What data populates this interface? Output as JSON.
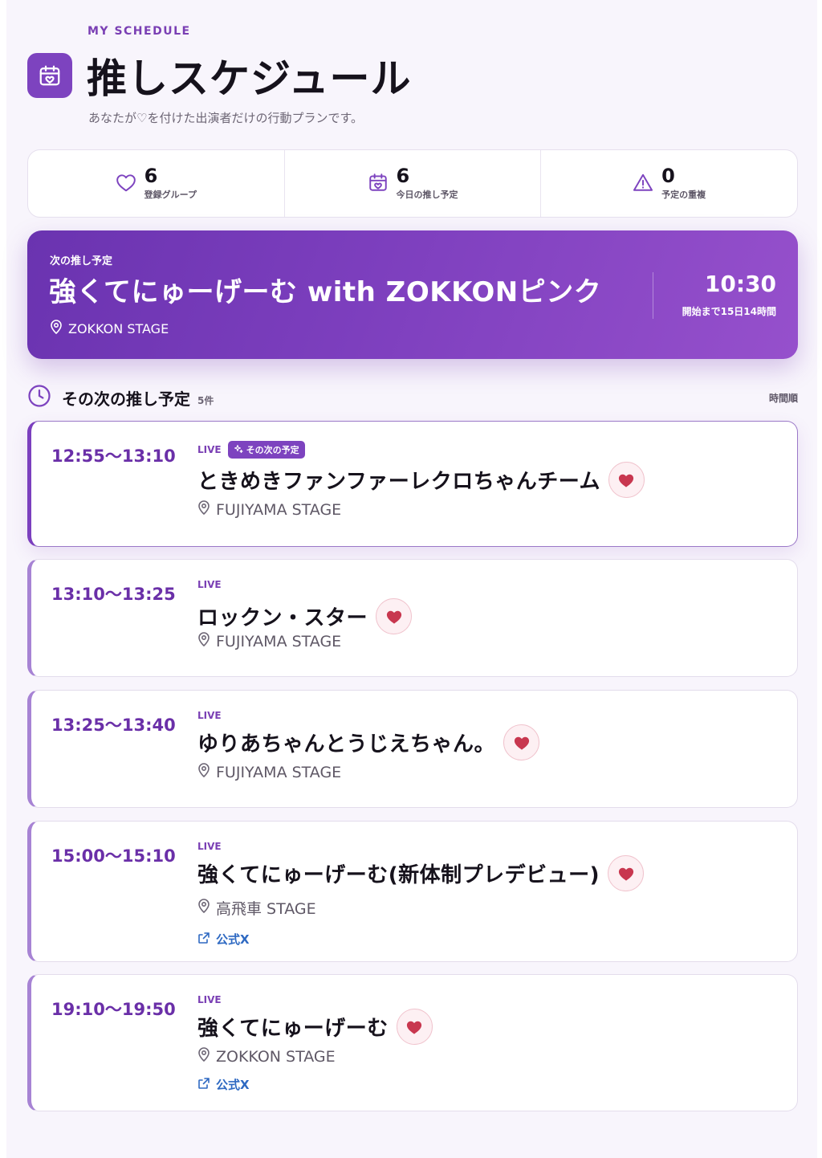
{
  "header": {
    "eyebrow": "MY SCHEDULE",
    "title": "推しスケジュール",
    "subtitle": "あなたが♡を付けた出演者だけの行動プランです。"
  },
  "stats": [
    {
      "value": "6",
      "label": "登録グループ",
      "icon": "heart-outline-icon"
    },
    {
      "value": "6",
      "label": "今日の推し予定",
      "icon": "calendar-heart-icon"
    },
    {
      "value": "0",
      "label": "予定の重複",
      "icon": "warning-icon"
    }
  ],
  "next": {
    "label": "次の推し予定",
    "name": "強くてにゅーげーむ with ZOKKONピンク",
    "stage": "ZOKKON STAGE",
    "time": "10:30",
    "countdown": "開始まで15日14時間"
  },
  "upcoming": {
    "title": "その次の推し予定",
    "count": "5件",
    "sort": "時間順",
    "items": [
      {
        "time": "12:55〜13:10",
        "type": "LIVE",
        "badge": "その次の予定",
        "name": "ときめきファンファーレクロちゃんチーム",
        "stage": "FUJIYAMA STAGE",
        "link": ""
      },
      {
        "time": "13:10〜13:25",
        "type": "LIVE",
        "badge": "",
        "name": "ロックン・スター",
        "stage": "FUJIYAMA STAGE",
        "link": ""
      },
      {
        "time": "13:25〜13:40",
        "type": "LIVE",
        "badge": "",
        "name": "ゆりあちゃんとうじえちゃん。",
        "stage": "FUJIYAMA STAGE",
        "link": ""
      },
      {
        "time": "15:00〜15:10",
        "type": "LIVE",
        "badge": "",
        "name": "強くてにゅーげーむ(新体制プレデビュー)",
        "stage": "高飛車 STAGE",
        "link": "公式X"
      },
      {
        "time": "19:10〜19:50",
        "type": "LIVE",
        "badge": "",
        "name": "強くてにゅーげーむ",
        "stage": "ZOKKON STAGE",
        "link": "公式X"
      }
    ]
  },
  "colors": {
    "accent": "#7d43bf",
    "heart": "#c8374f",
    "link": "#2e69c2"
  }
}
